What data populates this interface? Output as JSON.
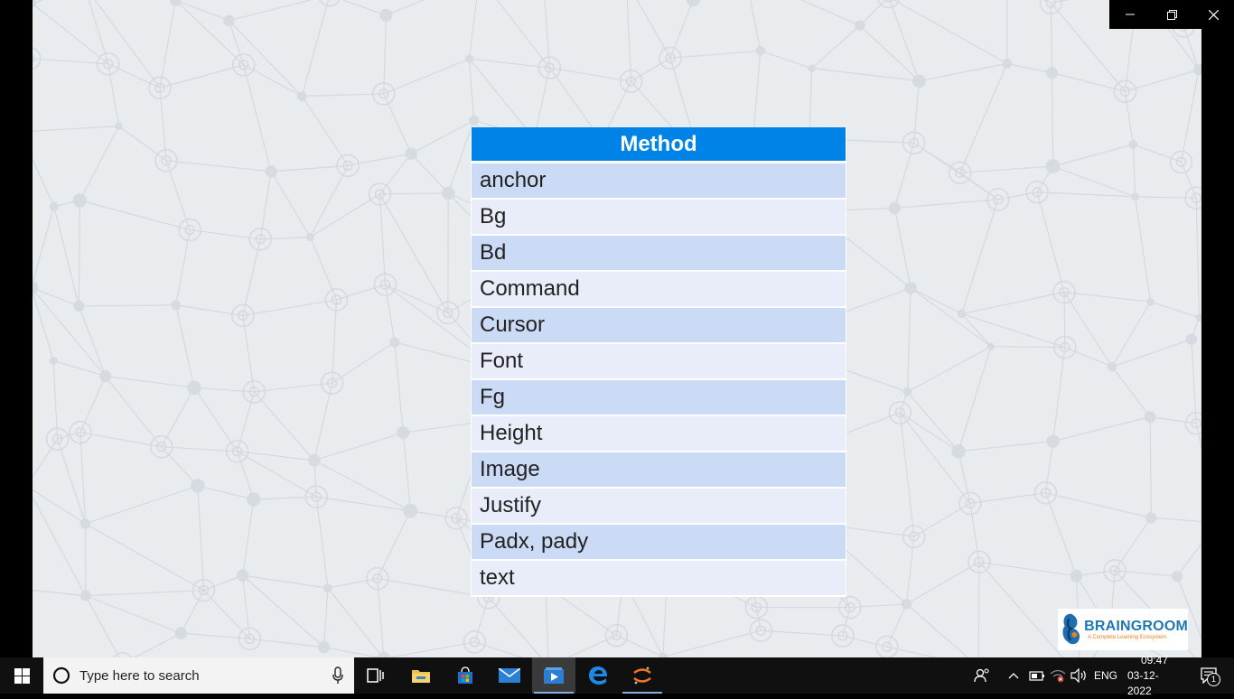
{
  "slide": {
    "table": {
      "header": "Method",
      "rows": [
        "anchor",
        "Bg",
        "Bd",
        "Command",
        "Cursor",
        "Font",
        "Fg",
        "Height",
        "Image",
        "Justify",
        "Padx, pady",
        "text"
      ]
    },
    "logo": {
      "name": "BRAINGROOM",
      "tagline": "A Complete Learning Ecosystem"
    }
  },
  "window_controls": {
    "icons": [
      "minimize-icon",
      "restore-icon",
      "close-icon"
    ]
  },
  "taskbar": {
    "search_placeholder": "Type here to search",
    "apps": [
      "task-view-icon",
      "file-explorer-icon",
      "store-icon",
      "mail-icon",
      "media-player-icon",
      "edge-icon",
      "jupyter-icon"
    ],
    "language": "ENG",
    "time": "09:47",
    "date": "03-12-2022",
    "notification_count": "1"
  },
  "colors": {
    "header_blue": "#0083e6",
    "row_odd": "#cbdaf5",
    "row_even": "#e8edf9",
    "slide_bg": "#e8ecef",
    "taskbar": "#101010"
  }
}
